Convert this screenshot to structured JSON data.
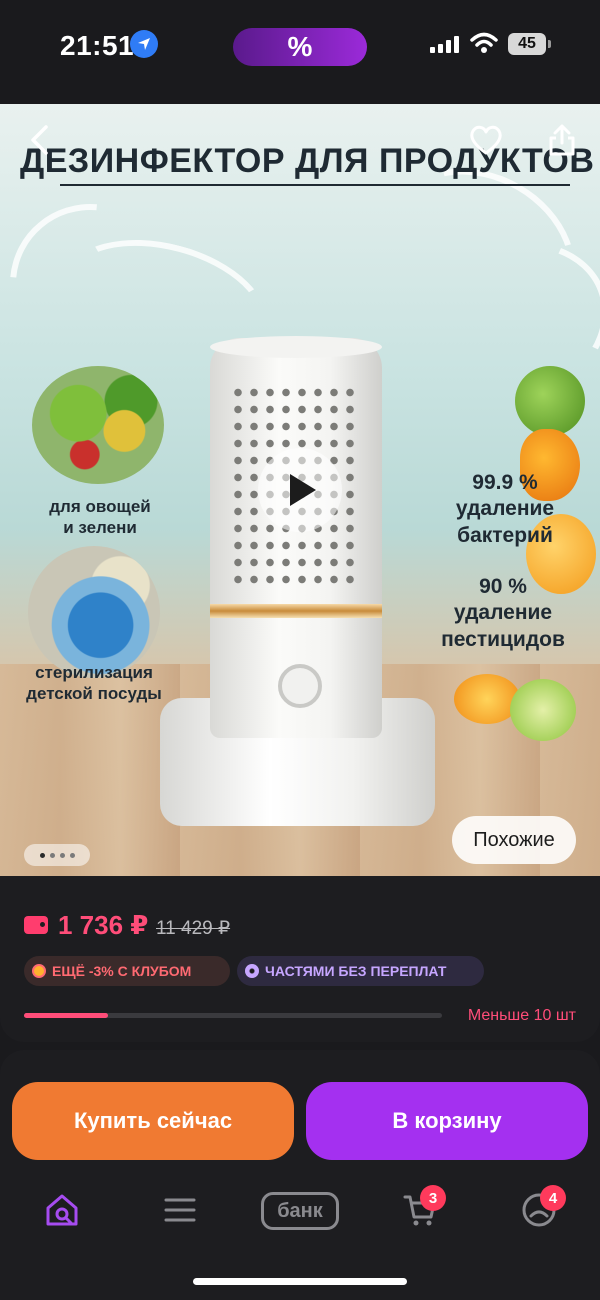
{
  "status_bar": {
    "time": "21:51",
    "island_label": "%",
    "battery": "45"
  },
  "product_image": {
    "title": "ДЕЗИНФЕКТОР ДЛЯ ПРОДУКТОВ",
    "caption_vegetables": "для овощей\nи зелени",
    "caption_dishes": "стерилизация\nдетской посуды",
    "stat_bacteria": "99.9 %\nудаление\nбактерий",
    "stat_pesticides": "90 %\nудаление\nпестицидов",
    "pager_count": 4,
    "pager_active": 1,
    "similar_label": "Похожие"
  },
  "price": {
    "current": "1 736 ₽",
    "old": "11 429 ₽",
    "club_chip": "ЕЩЁ -3% С КЛУБОМ",
    "parts_chip": "ЧАСТЯМИ БЕЗ ПЕРЕПЛАТ",
    "stock_text": "Меньше 10 шт",
    "stock_fraction": 0.2
  },
  "actions": {
    "buy_now": "Купить сейчас",
    "add_to_cart": "В корзину"
  },
  "tab_bar": {
    "bank_label": "банк",
    "cart_badge": "3",
    "profile_badge": "4"
  },
  "colors": {
    "accent_pink": "#ff4d79",
    "buy_orange": "#f07a32",
    "cart_purple": "#a430f0",
    "active_tab": "#a64cf0"
  }
}
